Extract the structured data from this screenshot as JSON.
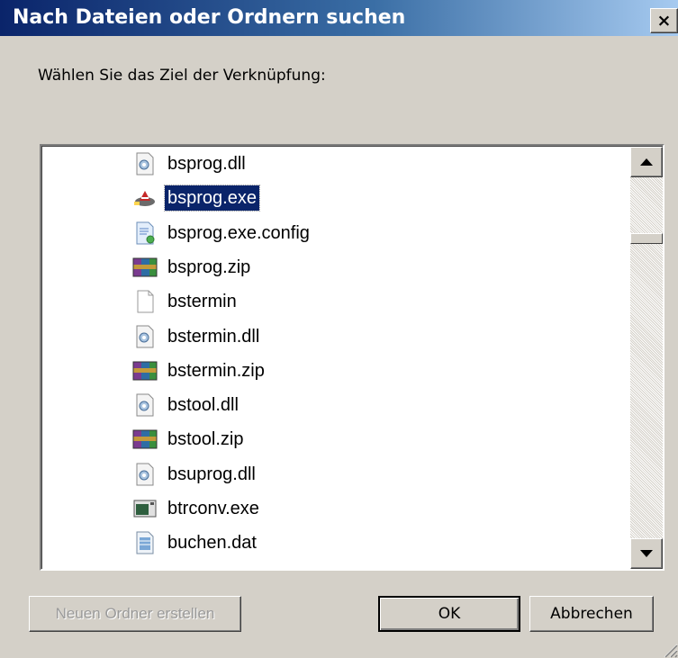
{
  "dialog": {
    "title": "Nach Dateien oder Ordnern suchen",
    "close_glyph": "×",
    "prompt": "Wählen Sie das Ziel der Verknüpfung:"
  },
  "files": [
    {
      "name": "bsprog.dll",
      "icon": "dll-icon",
      "selected": false
    },
    {
      "name": "bsprog.exe",
      "icon": "exe-app-icon",
      "selected": true
    },
    {
      "name": "bsprog.exe.config",
      "icon": "config-file-icon",
      "selected": false
    },
    {
      "name": "bsprog.zip",
      "icon": "winrar-archive-icon",
      "selected": false
    },
    {
      "name": "bstermin",
      "icon": "blank-file-icon",
      "selected": false
    },
    {
      "name": "bstermin.dll",
      "icon": "dll-icon",
      "selected": false
    },
    {
      "name": "bstermin.zip",
      "icon": "winrar-archive-icon",
      "selected": false
    },
    {
      "name": "bstool.dll",
      "icon": "dll-icon",
      "selected": false
    },
    {
      "name": "bstool.zip",
      "icon": "winrar-archive-icon",
      "selected": false
    },
    {
      "name": "bsuprog.dll",
      "icon": "dll-icon",
      "selected": false
    },
    {
      "name": "btrconv.exe",
      "icon": "console-exe-icon",
      "selected": false
    },
    {
      "name": "buchen.dat",
      "icon": "data-file-icon",
      "selected": false
    }
  ],
  "buttons": {
    "new_folder": "Neuen Ordner erstellen",
    "ok": "OK",
    "cancel": "Abbrechen"
  },
  "colors": {
    "title_gradient_start": "#0a246a",
    "title_gradient_end": "#a6caf0",
    "selection": "#0a246a",
    "face": "#d4d0c8"
  }
}
